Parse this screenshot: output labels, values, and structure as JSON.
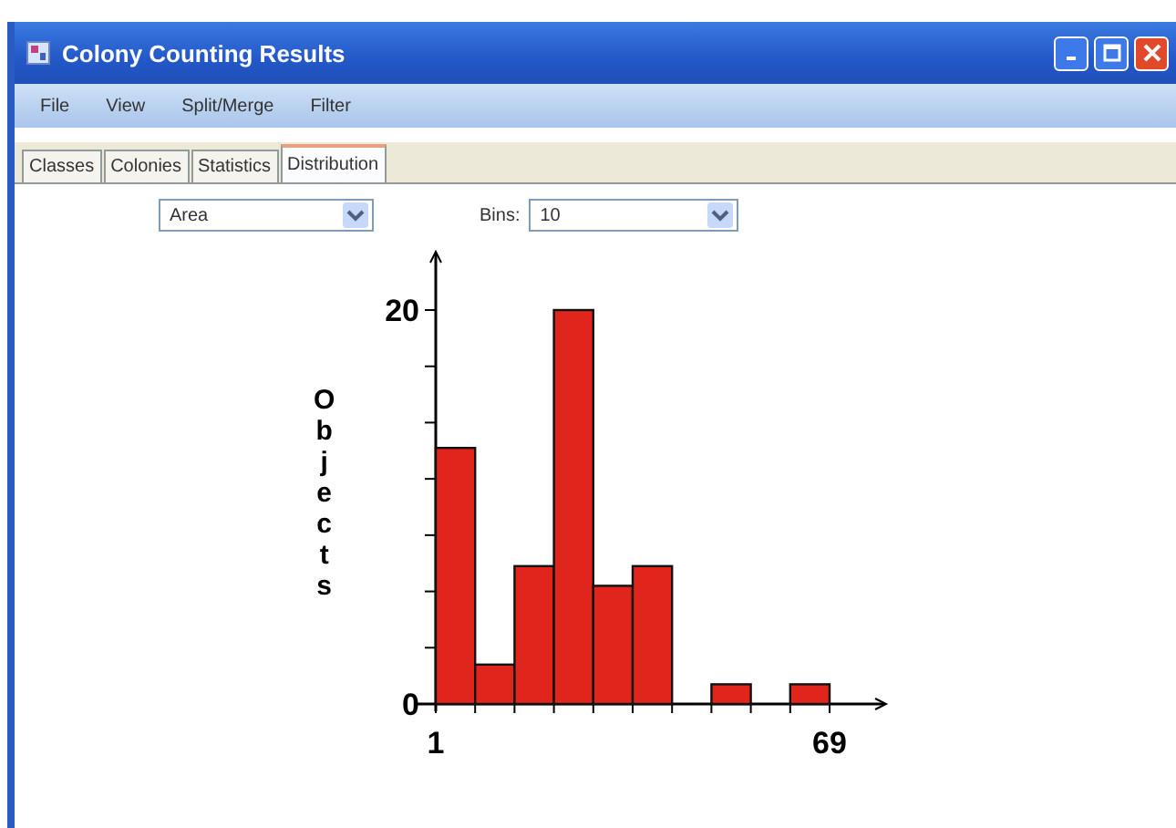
{
  "window": {
    "title": "Colony Counting Results"
  },
  "menu": [
    "File",
    "View",
    "Split/Merge",
    "Filter"
  ],
  "tabs": [
    {
      "label": "Classes",
      "selected": false
    },
    {
      "label": "Colonies",
      "selected": false
    },
    {
      "label": "Statistics",
      "selected": false
    },
    {
      "label": "Distribution",
      "selected": true
    }
  ],
  "measure": {
    "value": "Area"
  },
  "bins": {
    "label": "Bins:",
    "value": "10"
  },
  "chart": {
    "chart_data": {
      "type": "bar",
      "ylabel": "Objects",
      "x": [
        4.4,
        11.2,
        18,
        24.8,
        31.6,
        38.4,
        45.2,
        52,
        58.8,
        65.6
      ],
      "values": [
        13,
        2,
        7,
        20,
        6,
        7,
        0,
        1,
        0,
        1
      ],
      "xlim": [
        1,
        69
      ],
      "ylim": [
        0,
        20
      ],
      "xticks": [
        1,
        69
      ],
      "yticks": [
        0,
        20
      ]
    }
  }
}
